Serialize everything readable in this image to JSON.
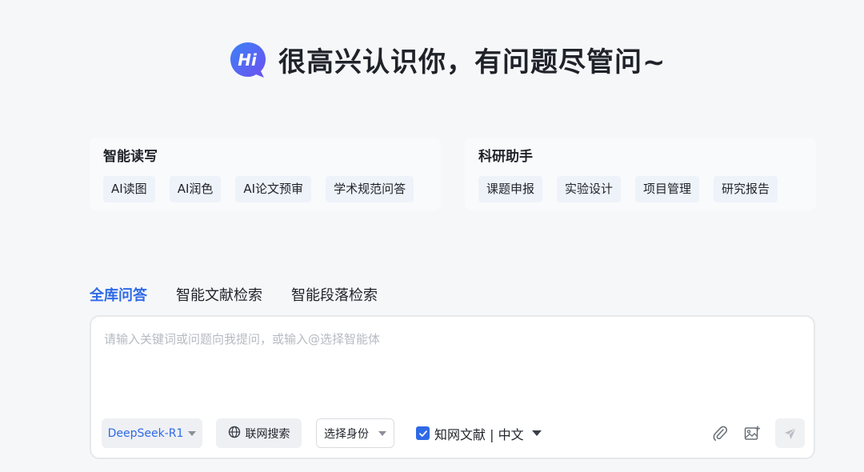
{
  "hero": {
    "logo_text": "Hi",
    "title": "很高兴认识你，有问题尽管问~"
  },
  "cards": [
    {
      "title": "智能读写",
      "chips": [
        "AI读图",
        "AI润色",
        "AI论文预审",
        "学术规范问答"
      ]
    },
    {
      "title": "科研助手",
      "chips": [
        "课题申报",
        "实验设计",
        "项目管理",
        "研究报告"
      ]
    }
  ],
  "tabs": [
    {
      "label": "全库问答",
      "active": true
    },
    {
      "label": "智能文献检索",
      "active": false
    },
    {
      "label": "智能段落检索",
      "active": false
    }
  ],
  "input": {
    "placeholder": "请输入关键词或问题向我提问，或输入@选择智能体",
    "value": ""
  },
  "toolbar": {
    "model": "DeepSeek-R1",
    "web_search": "联网搜索",
    "role_select": "选择身份",
    "source_checked": true,
    "source_label": "知网文献 | 中文"
  },
  "icons": [
    "globe-icon",
    "caret-down-icon",
    "checkmark-icon",
    "paperclip-icon",
    "image-upload-icon",
    "send-icon"
  ],
  "colors": {
    "accent": "#2f6ae6",
    "logo_gradient_start": "#3b82f6",
    "logo_gradient_end": "#6d4ff0",
    "background": "#f6f7f9",
    "chip_bg": "#eef3fa"
  }
}
